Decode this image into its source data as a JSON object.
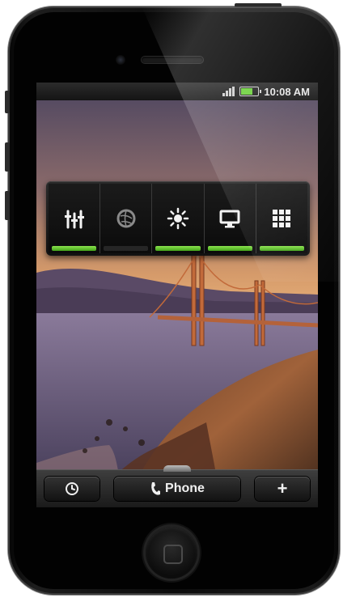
{
  "status_bar": {
    "time": "10:08 AM"
  },
  "power_widget": {
    "toggles": [
      {
        "icon": "equalizer-icon",
        "active": true
      },
      {
        "icon": "gps-icon",
        "active": false
      },
      {
        "icon": "brightness-icon",
        "active": true
      },
      {
        "icon": "screen-icon",
        "active": true
      },
      {
        "icon": "grid-icon",
        "active": true
      }
    ],
    "active_color": "#5cc62a"
  },
  "dock": {
    "left_icon": "clock-icon",
    "phone_label": "Phone",
    "phone_icon": "phone-icon",
    "right_label": "+"
  }
}
